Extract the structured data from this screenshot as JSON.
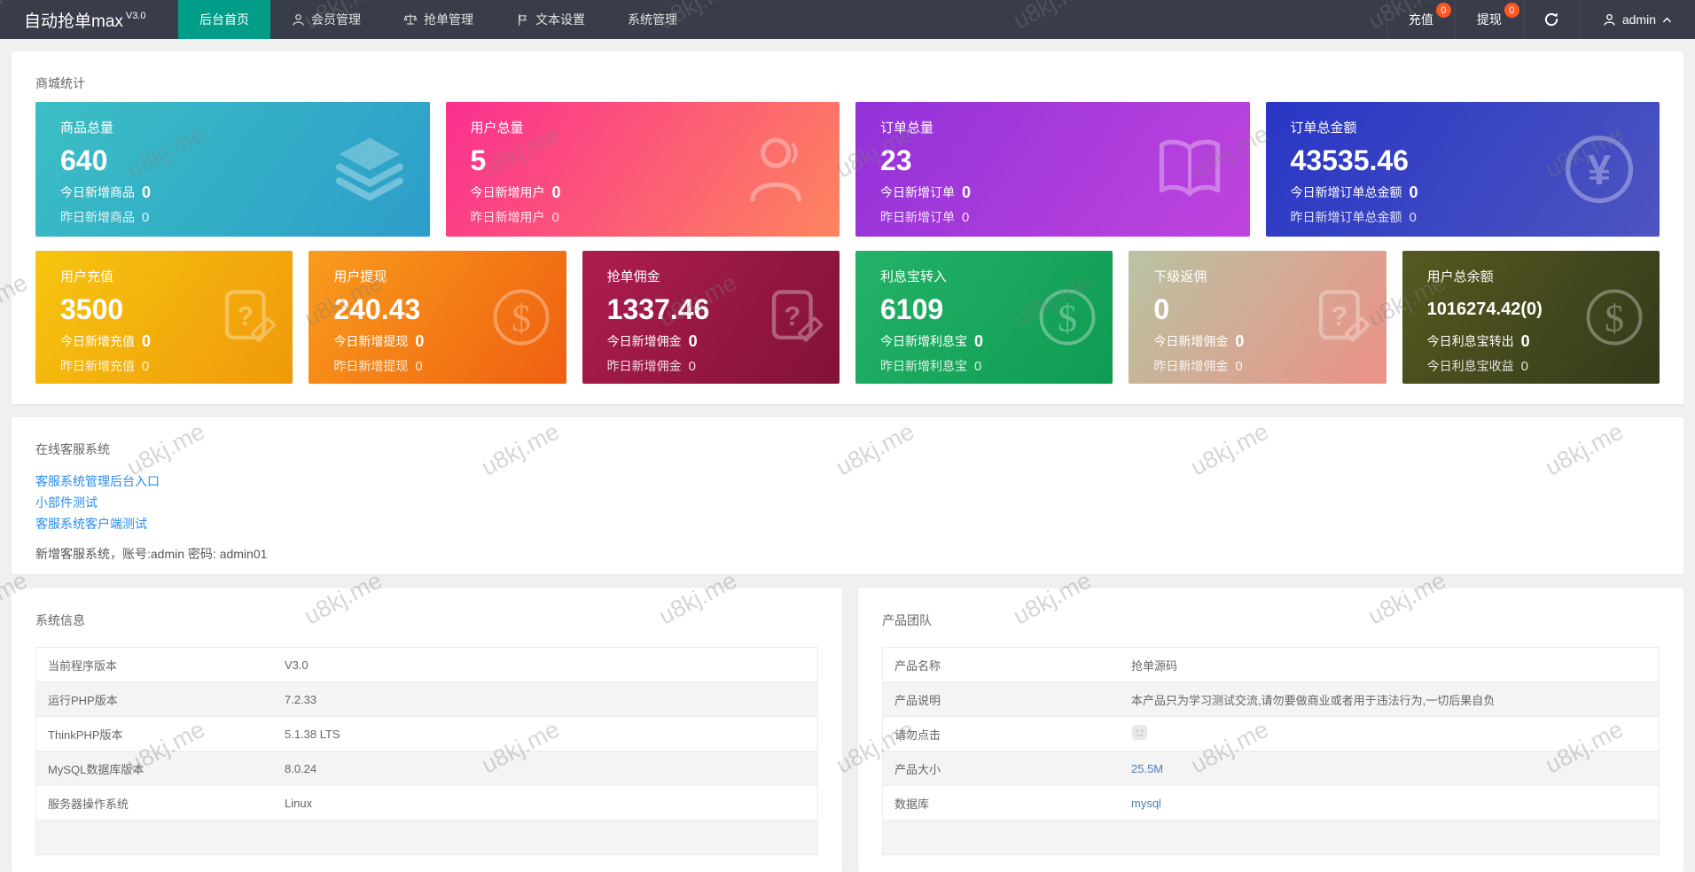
{
  "header": {
    "brand": "自动抢单max",
    "version": "V3.0",
    "nav": [
      {
        "label": "后台首页",
        "icon": null,
        "active": true
      },
      {
        "label": "会员管理",
        "icon": "user",
        "active": false
      },
      {
        "label": "抢单管理",
        "icon": "scale",
        "active": false
      },
      {
        "label": "文本设置",
        "icon": "flag",
        "active": false
      },
      {
        "label": "系统管理",
        "icon": null,
        "active": false
      }
    ],
    "actions": [
      {
        "label": "充值",
        "badge": "0"
      },
      {
        "label": "提现",
        "badge": "0"
      }
    ],
    "user": {
      "name": "admin"
    }
  },
  "colors": {
    "header_bg": "#393D49",
    "active_tab_green": "#019D88",
    "badge_orange": "#FF5722",
    "link_blue": "#2B8CEB",
    "table_link_blue": "#4A7EBB"
  },
  "stats": {
    "section_title": "商城统计",
    "row1": [
      {
        "title": "商品总量",
        "value": "640",
        "icon": "layers",
        "bg": [
          "#3bbfc4",
          "#2d9dca"
        ],
        "lines": [
          {
            "label": "今日新增商品",
            "value": "0"
          },
          {
            "label": "昨日新增商品",
            "value": "0"
          }
        ]
      },
      {
        "title": "用户总量",
        "value": "5",
        "icon": "person",
        "bg": [
          "#fb2f90",
          "#fd855e"
        ],
        "lines": [
          {
            "label": "今日新增用户",
            "value": "0"
          },
          {
            "label": "昨日新增用户",
            "value": "0"
          }
        ]
      },
      {
        "title": "订单总量",
        "value": "23",
        "icon": "book",
        "bg": [
          "#9232d8",
          "#c044de"
        ],
        "lines": [
          {
            "label": "今日新增订单",
            "value": "0"
          },
          {
            "label": "昨日新增订单",
            "value": "0"
          }
        ]
      },
      {
        "title": "订单总金额",
        "value": "43535.46",
        "icon": "yen-circle",
        "bg": [
          "#2836c4",
          "#4d55c0"
        ],
        "lines": [
          {
            "label": "今日新增订单总金额",
            "value": "0"
          },
          {
            "label": "昨日新增订单总金额",
            "value": "0"
          }
        ]
      }
    ],
    "row2": [
      {
        "title": "用户充值",
        "value": "3500",
        "icon": "doc-question",
        "bg": [
          "#f6c50f",
          "#f0990b"
        ],
        "lines": [
          {
            "label": "今日新增充值",
            "value": "0"
          },
          {
            "label": "昨日新增充值",
            "value": "0"
          }
        ]
      },
      {
        "title": "用户提现",
        "value": "240.43",
        "icon": "dollar-circle",
        "bg": [
          "#f99c1c",
          "#ef5f11"
        ],
        "lines": [
          {
            "label": "今日新增提现",
            "value": "0"
          },
          {
            "label": "昨日新增提现",
            "value": "0"
          }
        ]
      },
      {
        "title": "抢单佣金",
        "value": "1337.46",
        "icon": "doc-question",
        "bg": [
          "#ad1d50",
          "#821236"
        ],
        "lines": [
          {
            "label": "今日新增佣金",
            "value": "0"
          },
          {
            "label": "昨日新增佣金",
            "value": "0"
          }
        ]
      },
      {
        "title": "利息宝转入",
        "value": "6109",
        "icon": "dollar-circle",
        "bg": [
          "#23b268",
          "#0f9b52"
        ],
        "lines": [
          {
            "label": "今日新增利息宝",
            "value": "0"
          },
          {
            "label": "昨日新增利息宝",
            "value": "0"
          }
        ]
      },
      {
        "title": "下级返佣",
        "value": "0",
        "icon": "doc-question",
        "bg": [
          "#b9c3a3",
          "#ec9186"
        ],
        "lines": [
          {
            "label": "今日新增佣金",
            "value": "0"
          },
          {
            "label": "昨日新增佣金",
            "value": "0"
          }
        ]
      },
      {
        "title": "用户总余额",
        "value": "1016274.42(0)",
        "small": true,
        "icon": "dollar-circle",
        "bg": [
          "#56591f",
          "#34391c"
        ],
        "lines": [
          {
            "label": "今日利息宝转出",
            "value": "0"
          },
          {
            "label": "今日利息宝收益",
            "value": "0"
          }
        ]
      }
    ]
  },
  "service": {
    "title": "在线客服系统",
    "links": [
      "客服系统管理后台入口",
      "小部件测试",
      "客服系统客户端测试"
    ],
    "note": "新增客服系统，账号:admin 密码: admin01"
  },
  "system_info": {
    "title": "系统信息",
    "rows": [
      {
        "label": "当前程序版本",
        "value": "V3.0"
      },
      {
        "label": "运行PHP版本",
        "value": "7.2.33"
      },
      {
        "label": "ThinkPHP版本",
        "value": "5.1.38 LTS"
      },
      {
        "label": "MySQL数据库版本",
        "value": "8.0.24"
      },
      {
        "label": "服务器操作系统",
        "value": "Linux"
      },
      {
        "label": "",
        "value": ""
      }
    ]
  },
  "product_team": {
    "title": "产品团队",
    "rows": [
      {
        "label": "产品名称",
        "value": "抢单源码"
      },
      {
        "label": "产品说明",
        "value": "本产品只为学习测试交流,请勿要做商业或者用于违法行为,一切后果自负"
      },
      {
        "label": "请勿点击",
        "value": "",
        "icon": "emoji-face"
      },
      {
        "label": "产品大小",
        "value": "25.5M",
        "link": true
      },
      {
        "label": "数据库",
        "value": "mysql",
        "link": true
      },
      {
        "label": "",
        "value": ""
      }
    ]
  },
  "watermark": {
    "text": "u8kj.me"
  }
}
